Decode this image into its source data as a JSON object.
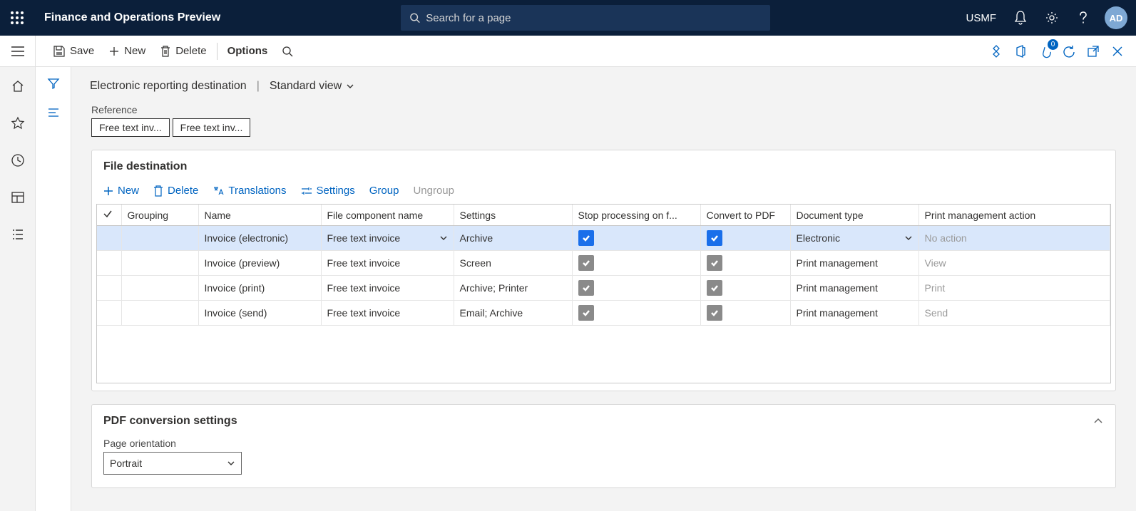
{
  "header": {
    "app_title": "Finance and Operations Preview",
    "search_placeholder": "Search for a page",
    "entity": "USMF",
    "avatar": "AD",
    "attach_count": "0"
  },
  "actions": {
    "save": "Save",
    "new": "New",
    "delete": "Delete",
    "options": "Options"
  },
  "breadcrumb": {
    "title": "Electronic reporting destination",
    "view": "Standard view"
  },
  "reference": {
    "label": "Reference",
    "tags": [
      "Free text inv...",
      "Free text inv..."
    ]
  },
  "file_dest": {
    "title": "File destination",
    "toolbar": {
      "new": "New",
      "delete": "Delete",
      "translations": "Translations",
      "settings": "Settings",
      "group": "Group",
      "ungroup": "Ungroup"
    },
    "cols": {
      "grouping": "Grouping",
      "name": "Name",
      "component": "File component name",
      "settings": "Settings",
      "stop": "Stop processing on f...",
      "convert": "Convert to PDF",
      "doctype": "Document type",
      "pmaction": "Print management action"
    },
    "rows": [
      {
        "name": "Invoice (electronic)",
        "component": "Free text invoice",
        "settings": "Archive",
        "doctype": "Electronic",
        "pm": "No action",
        "selected": true,
        "pmdim": true
      },
      {
        "name": "Invoice (preview)",
        "component": "Free text invoice",
        "settings": "Screen",
        "doctype": "Print management",
        "pm": "View",
        "selected": false,
        "pmdim": true
      },
      {
        "name": "Invoice (print)",
        "component": "Free text invoice",
        "settings": "Archive; Printer",
        "doctype": "Print management",
        "pm": "Print",
        "selected": false,
        "pmdim": true
      },
      {
        "name": "Invoice (send)",
        "component": "Free text invoice",
        "settings": "Email; Archive",
        "doctype": "Print management",
        "pm": "Send",
        "selected": false,
        "pmdim": true
      }
    ]
  },
  "pdf": {
    "title": "PDF conversion settings",
    "orientation_label": "Page orientation",
    "orientation_value": "Portrait"
  }
}
